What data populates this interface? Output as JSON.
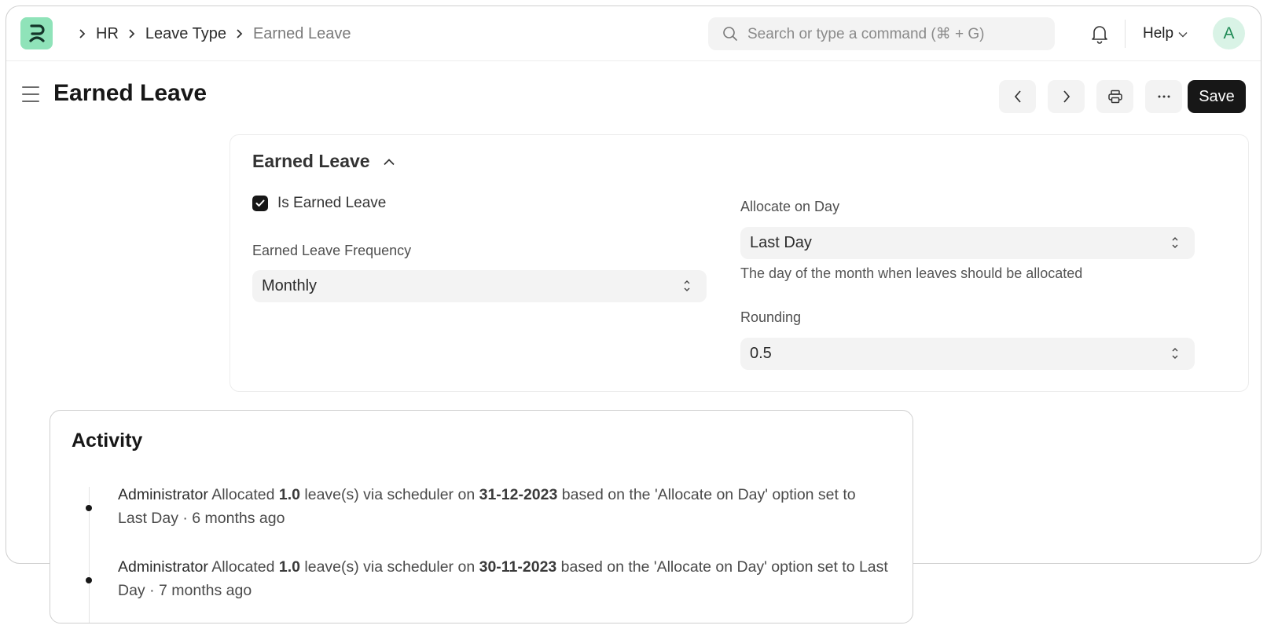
{
  "navbar": {
    "logo": "frappe-hr-logo",
    "breadcrumbs": [
      "HR",
      "Leave Type",
      "Earned Leave"
    ],
    "search_placeholder": "Search or type a command (⌘ + G)",
    "help_label": "Help",
    "avatar_initial": "A"
  },
  "page": {
    "title": "Earned Leave",
    "save_label": "Save"
  },
  "section": {
    "title": "Earned Leave",
    "is_earned_leave_label": "Is Earned Leave",
    "is_earned_leave_checked": true,
    "frequency_label": "Earned Leave Frequency",
    "frequency_value": "Monthly",
    "allocate_label": "Allocate on Day",
    "allocate_value": "Last Day",
    "allocate_help": "The day of the month when leaves should be allocated",
    "rounding_label": "Rounding",
    "rounding_value": "0.5"
  },
  "activity": {
    "title": "Activity",
    "items": [
      {
        "user": "Administrator",
        "pre": " Allocated ",
        "amount": "1.0",
        "mid": " leave(s) via scheduler on ",
        "date": "31-12-2023",
        "post": " based on the 'Allocate on Day' option set to Last Day · ",
        "time": "6 months ago"
      },
      {
        "user": "Administrator",
        "pre": " Allocated ",
        "amount": "1.0",
        "mid": " leave(s) via scheduler on ",
        "date": "30-11-2023",
        "post": " based on the 'Allocate on Day' option set to Last Day · ",
        "time": "7 months ago"
      }
    ]
  },
  "colors": {
    "logo_bg": "#8fe3b9",
    "primary_button": "#171717",
    "avatar_bg": "#d9f3e6",
    "avatar_text": "#1f8a55"
  }
}
